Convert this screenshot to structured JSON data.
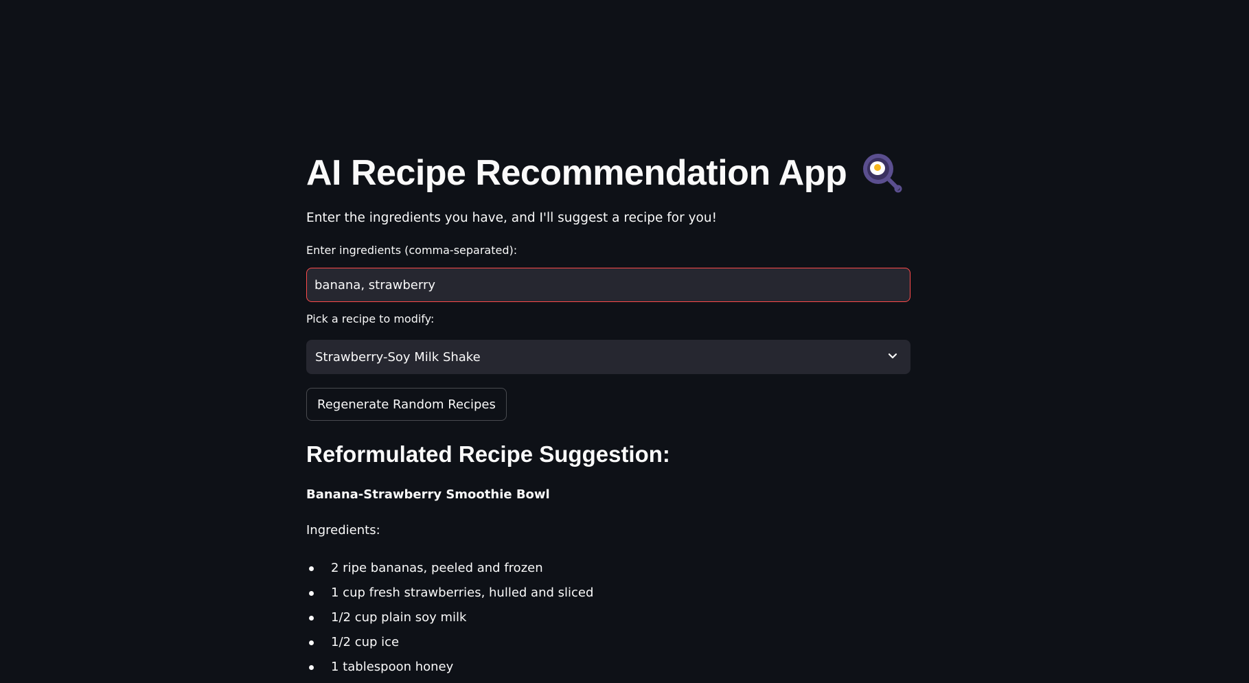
{
  "app": {
    "title": "AI Recipe Recommendation App",
    "title_icon": "frying-pan-with-egg-icon",
    "subtitle": "Enter the ingredients you have, and I'll suggest a recipe for you!"
  },
  "ingredients_input": {
    "label": "Enter ingredients (comma-separated):",
    "value": "banana, strawberry"
  },
  "recipe_select": {
    "label": "Pick a recipe to modify:",
    "selected": "Strawberry-Soy Milk Shake"
  },
  "regenerate_button": {
    "label": "Regenerate Random Recipes"
  },
  "result": {
    "heading": "Reformulated Recipe Suggestion:",
    "recipe_name": "Banana-Strawberry Smoothie Bowl",
    "ingredients_heading": "Ingredients:",
    "ingredients": [
      "2 ripe bananas, peeled and frozen",
      "1 cup fresh strawberries, hulled and sliced",
      "1/2 cup plain soy milk",
      "1/2 cup ice",
      "1 tablespoon honey"
    ]
  },
  "colors": {
    "background": "#0e1117",
    "input_background": "#262730",
    "focus_border": "#ff4b4b",
    "text": "#fafafa"
  }
}
